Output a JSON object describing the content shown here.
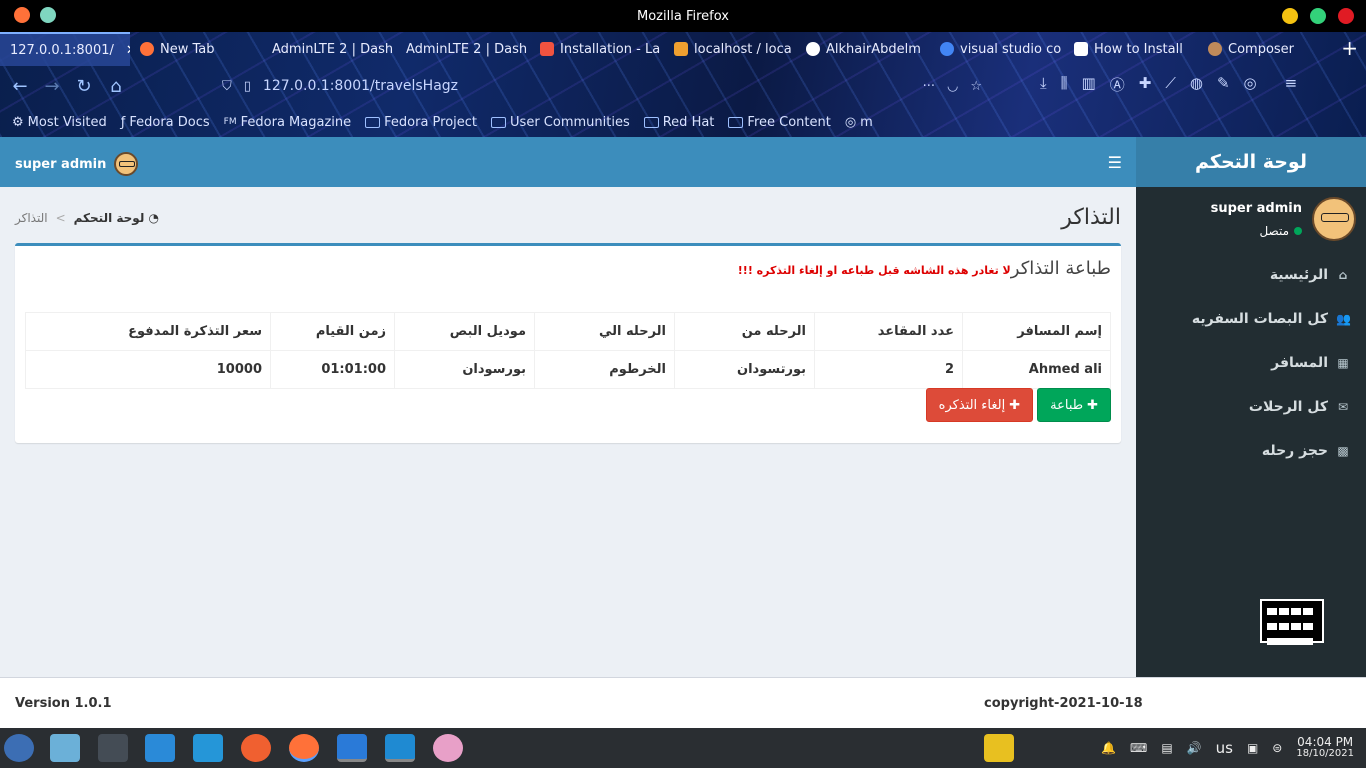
{
  "window": {
    "title": "Mozilla Firefox"
  },
  "tabs": [
    {
      "label": "127.0.0.1:8001/",
      "active": true
    },
    {
      "label": "New Tab"
    },
    {
      "label": "AdminLTE 2 | Dash"
    },
    {
      "label": "AdminLTE 2 | Dash"
    },
    {
      "label": "Installation - La"
    },
    {
      "label": "localhost / loca"
    },
    {
      "label": "AlkhairAbdelm"
    },
    {
      "label": "visual studio co"
    },
    {
      "label": "How to Install"
    },
    {
      "label": "Composer"
    }
  ],
  "url": {
    "text": "127.0.0.1:8001/travelsHagz"
  },
  "bookmarks": [
    {
      "label": "Most Visited"
    },
    {
      "label": "Fedora Docs"
    },
    {
      "label": "Fedora Magazine"
    },
    {
      "label": "Fedora Project"
    },
    {
      "label": "User Communities"
    },
    {
      "label": "Red Hat"
    },
    {
      "label": "Free Content"
    },
    {
      "label": "m"
    }
  ],
  "topnav": {
    "user": "super admin"
  },
  "logo": "لوحة التحكم",
  "sidebar": {
    "user": "super admin",
    "status": "متصل",
    "items": [
      {
        "label": "الرئيسية",
        "icon": "home-icon"
      },
      {
        "label": "كل البصات السفريه",
        "icon": "users-icon"
      },
      {
        "label": "المسافر",
        "icon": "building-icon"
      },
      {
        "label": "كل الرحلات",
        "icon": "envelope-icon"
      },
      {
        "label": "حجز رحله",
        "icon": "grid-icon"
      }
    ]
  },
  "content": {
    "title": "التذاكر",
    "breadcrumb": {
      "home": "لوحة التحكم",
      "current": "التذاكر"
    },
    "box_title": "طباعة التذاكر",
    "warning": "لا تغادر هذه الشاشه قبل طباعه او إلغاء التذكره !!!",
    "table": {
      "headers": [
        "إسم المسافر",
        "عدد المقاعد",
        "الرحله من",
        "الرحله الي",
        "موديل البص",
        "زمن القيام",
        "سعر التذكرة المدفوع"
      ],
      "rows": [
        [
          "Ahmed ali",
          "2",
          "بورتسودان",
          "الخرطوم",
          "بورسودان",
          "01:01:00",
          "10000"
        ]
      ]
    },
    "print_button": "طباعة",
    "cancel_button": "إلغاء التذكره"
  },
  "footer": {
    "version": "Version 1.0.1",
    "copyright": "copyright-2021-10-18"
  },
  "taskbar": {
    "layout": "us",
    "time": "04:04 PM",
    "date": "18/10/2021"
  }
}
